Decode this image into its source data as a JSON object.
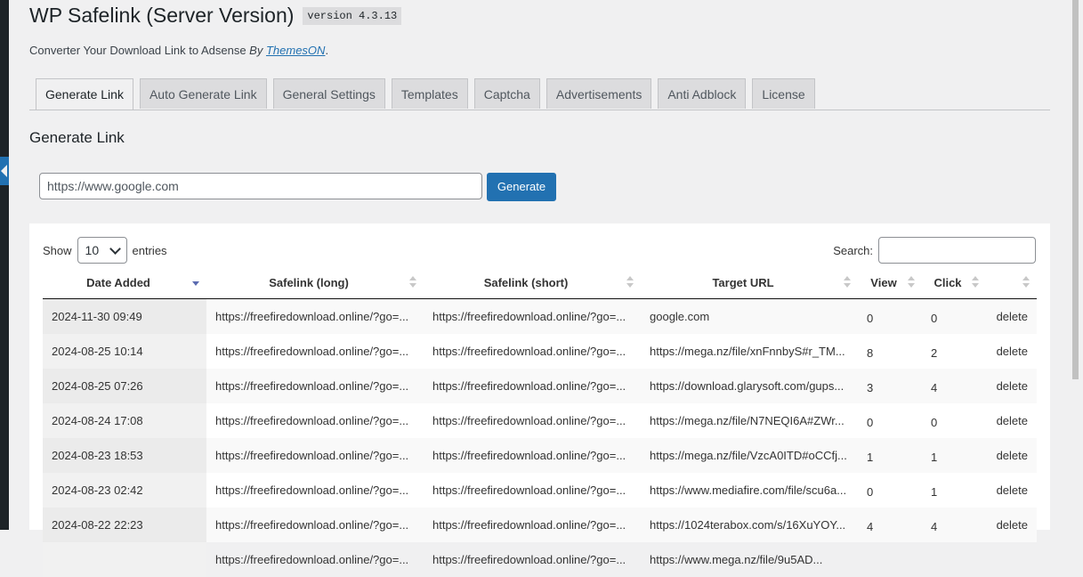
{
  "header": {
    "title": "WP Safelink (Server Version)",
    "version": "version 4.3.13",
    "subtitle_prefix": "Converter Your Download Link to Adsense",
    "subtitle_by": "By",
    "subtitle_link": "ThemesON",
    "subtitle_suffix": "."
  },
  "tabs": [
    {
      "label": "Generate Link",
      "active": true
    },
    {
      "label": "Auto Generate Link"
    },
    {
      "label": "General Settings"
    },
    {
      "label": "Templates"
    },
    {
      "label": "Captcha"
    },
    {
      "label": "Advertisements"
    },
    {
      "label": "Anti Adblock"
    },
    {
      "label": "License"
    }
  ],
  "section_title": "Generate Link",
  "generate": {
    "input_placeholder": "https://www.google.com",
    "button_label": "Generate"
  },
  "table_controls": {
    "show_label": "Show",
    "entries_value": "10",
    "entries_label": "entries",
    "search_label": "Search:"
  },
  "columns": [
    "Date Added",
    "Safelink (long)",
    "Safelink (short)",
    "Target URL",
    "View",
    "Click",
    ""
  ],
  "rows": [
    {
      "date": "2024-11-30 09:49",
      "long": "https://freefiredownload.online/?go=...",
      "short": "https://freefiredownload.online/?go=...",
      "target": "google.com",
      "view": "0",
      "click": "0",
      "action": "delete"
    },
    {
      "date": "2024-08-25 10:14",
      "long": "https://freefiredownload.online/?go=...",
      "short": "https://freefiredownload.online/?go=...",
      "target": "https://mega.nz/file/xnFnnbyS#r_TM...",
      "view": "8",
      "click": "2",
      "action": "delete"
    },
    {
      "date": "2024-08-25 07:26",
      "long": "https://freefiredownload.online/?go=...",
      "short": "https://freefiredownload.online/?go=...",
      "target": "https://download.glarysoft.com/gups...",
      "view": "3",
      "click": "4",
      "action": "delete"
    },
    {
      "date": "2024-08-24 17:08",
      "long": "https://freefiredownload.online/?go=...",
      "short": "https://freefiredownload.online/?go=...",
      "target": "https://mega.nz/file/N7NEQI6A#ZWr...",
      "view": "0",
      "click": "0",
      "action": "delete"
    },
    {
      "date": "2024-08-23 18:53",
      "long": "https://freefiredownload.online/?go=...",
      "short": "https://freefiredownload.online/?go=...",
      "target": "https://mega.nz/file/VzcA0ITD#oCCfj...",
      "view": "1",
      "click": "1",
      "action": "delete"
    },
    {
      "date": "2024-08-23 02:42",
      "long": "https://freefiredownload.online/?go=...",
      "short": "https://freefiredownload.online/?go=...",
      "target": "https://www.mediafire.com/file/scu6a...",
      "view": "0",
      "click": "1",
      "action": "delete"
    },
    {
      "date": "2024-08-22 22:23",
      "long": "https://freefiredownload.online/?go=...",
      "short": "https://freefiredownload.online/?go=...",
      "target": "https://1024terabox.com/s/16XuYOY...",
      "view": "4",
      "click": "4",
      "action": "delete"
    },
    {
      "date": "",
      "long": "https://freefiredownload.online/?go=...",
      "short": "https://freefiredownload.online/?go=...",
      "target": "https://www.mega.nz/file/9u5AD...",
      "view": "",
      "click": "",
      "action": ""
    }
  ],
  "icons": {
    "left_collapse": "collapse-arrow-icon",
    "entries_dropdown": "chevron-down-icon",
    "sort": "sort-icon"
  },
  "colors": {
    "accent": "#2271b1",
    "background": "#f0f0f1",
    "sidebar": "#1d2327"
  }
}
